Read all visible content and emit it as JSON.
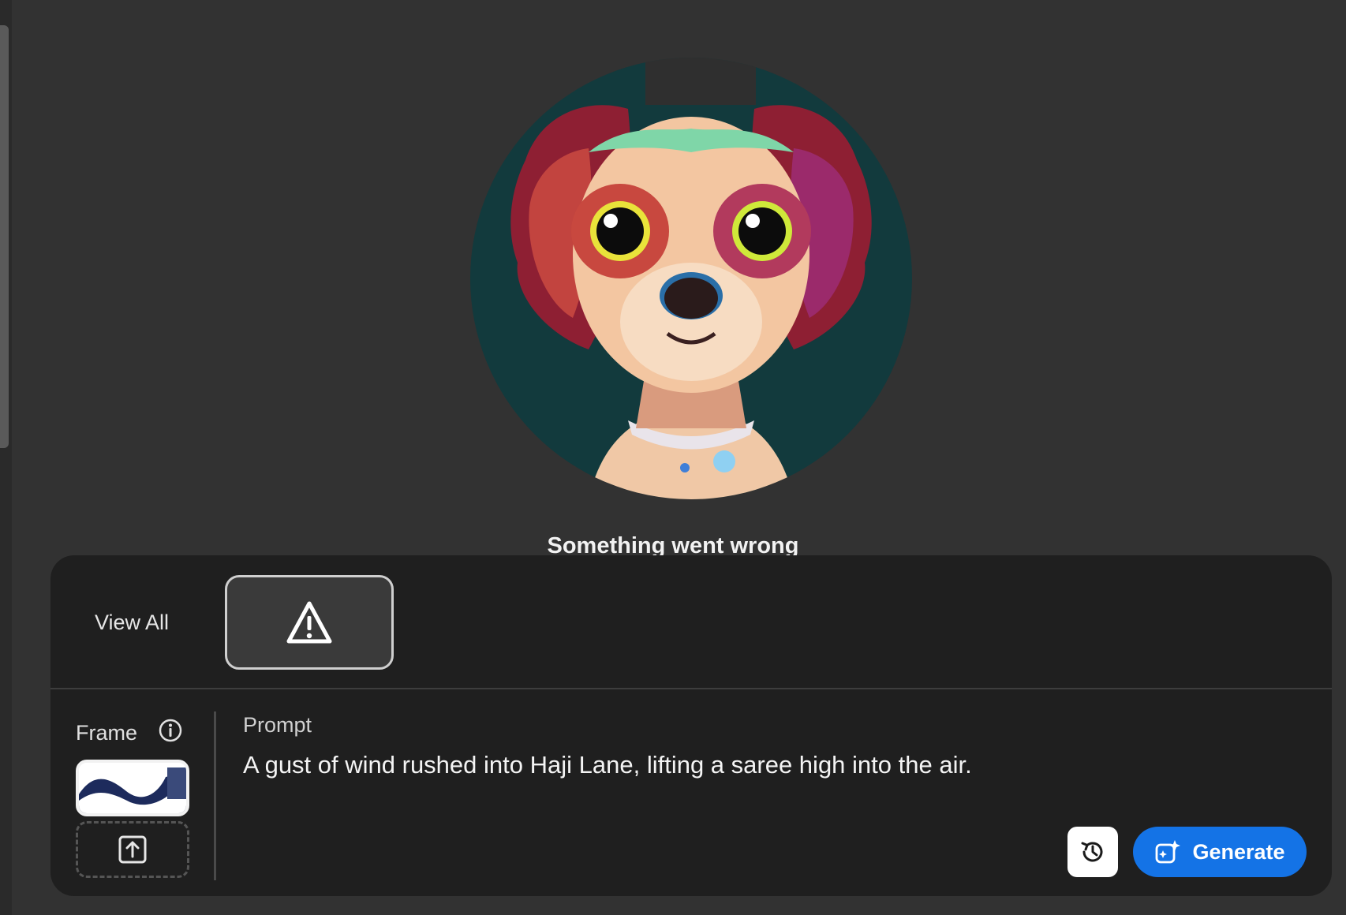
{
  "hero": {
    "image": "cartoon-puppy-portrait",
    "error_message": "Something went wrong"
  },
  "gallery": {
    "view_all_label": "View All",
    "items": [
      {
        "state": "error",
        "icon": "warning-triangle-icon"
      }
    ]
  },
  "frame": {
    "label": "Frame",
    "info_icon": "info-icon",
    "thumbnail": "frame-reference-image",
    "upload_icon": "upload-icon"
  },
  "prompt": {
    "label": "Prompt",
    "text": "A gust of wind rushed into Haji Lane, lifting a saree high into the air."
  },
  "actions": {
    "history_icon": "history-icon",
    "generate_label": "Generate",
    "generate_icon": "generate-sparkle-icon"
  },
  "colors": {
    "background": "#323232",
    "panel": "#1f1f1f",
    "accent": "#1473e6"
  }
}
